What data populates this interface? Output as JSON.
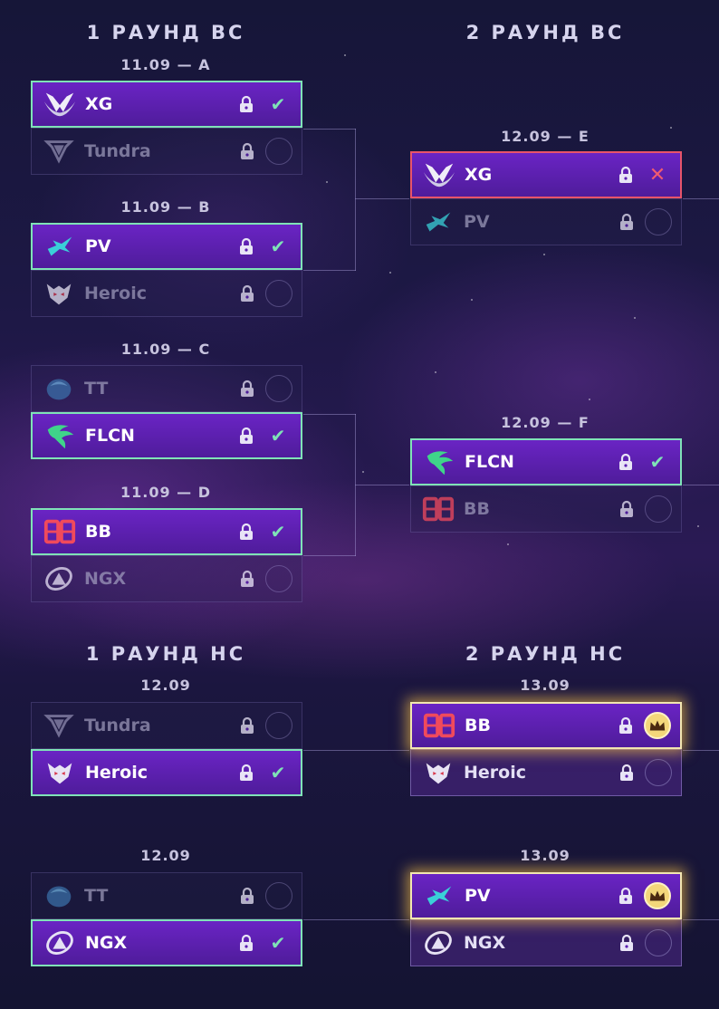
{
  "colors": {
    "win_border": "#7fe3b7",
    "lose_border": "#e8546a",
    "crown": "#f3d77a",
    "panel": "#5a1fb0"
  },
  "upper": {
    "round1": {
      "title": "1 РАУНД ВС",
      "matches": [
        {
          "label": "11.09 — A",
          "top": {
            "name": "XG",
            "logo": "xg-logo",
            "state": "win",
            "status": "check"
          },
          "bottom": {
            "name": "Tundra",
            "logo": "tundra-logo",
            "state": "dim",
            "status": "empty"
          }
        },
        {
          "label": "11.09 — B",
          "top": {
            "name": "PV",
            "logo": "pv-logo",
            "state": "win",
            "status": "check"
          },
          "bottom": {
            "name": "Heroic",
            "logo": "heroic-logo",
            "state": "dim",
            "status": "empty"
          }
        },
        {
          "label": "11.09 — C",
          "top": {
            "name": "TT",
            "logo": "tt-logo",
            "state": "dim",
            "status": "empty"
          },
          "bottom": {
            "name": "FLCN",
            "logo": "flcn-logo",
            "state": "win",
            "status": "check"
          }
        },
        {
          "label": "11.09 — D",
          "top": {
            "name": "BB",
            "logo": "bb-logo",
            "state": "win",
            "status": "check"
          },
          "bottom": {
            "name": "NGX",
            "logo": "ngx-logo",
            "state": "dim",
            "status": "empty"
          }
        }
      ]
    },
    "round2": {
      "title": "2 РАУНД ВС",
      "matches": [
        {
          "label": "12.09 — E",
          "top": {
            "name": "XG",
            "logo": "xg-logo",
            "state": "lost",
            "status": "cross"
          },
          "bottom": {
            "name": "PV",
            "logo": "pv-logo",
            "state": "dim",
            "status": "empty"
          }
        },
        {
          "label": "12.09 — F",
          "top": {
            "name": "FLCN",
            "logo": "flcn-logo",
            "state": "win",
            "status": "check"
          },
          "bottom": {
            "name": "BB",
            "logo": "bb-logo",
            "state": "dim",
            "status": "empty"
          }
        }
      ]
    }
  },
  "lower": {
    "round1": {
      "title": "1 РАУНД НС",
      "matches": [
        {
          "label": "12.09",
          "top": {
            "name": "Tundra",
            "logo": "tundra-logo",
            "state": "dim",
            "status": "empty"
          },
          "bottom": {
            "name": "Heroic",
            "logo": "heroic-logo",
            "state": "win",
            "status": "check"
          }
        },
        {
          "label": "12.09",
          "top": {
            "name": "TT",
            "logo": "tt-logo",
            "state": "dim",
            "status": "empty"
          },
          "bottom": {
            "name": "NGX",
            "logo": "ngx-logo",
            "state": "win",
            "status": "check"
          }
        }
      ]
    },
    "round2": {
      "title": "2 РАУНД НС",
      "matches": [
        {
          "label": "13.09",
          "top": {
            "name": "BB",
            "logo": "bb-logo",
            "state": "gold",
            "status": "crown"
          },
          "bottom": {
            "name": "Heroic",
            "logo": "heroic-logo",
            "state": "dim-purple",
            "status": "empty"
          }
        },
        {
          "label": "13.09",
          "top": {
            "name": "PV",
            "logo": "pv-logo",
            "state": "gold",
            "status": "crown"
          },
          "bottom": {
            "name": "NGX",
            "logo": "ngx-logo",
            "state": "dim-purple",
            "status": "empty"
          }
        }
      ]
    }
  }
}
